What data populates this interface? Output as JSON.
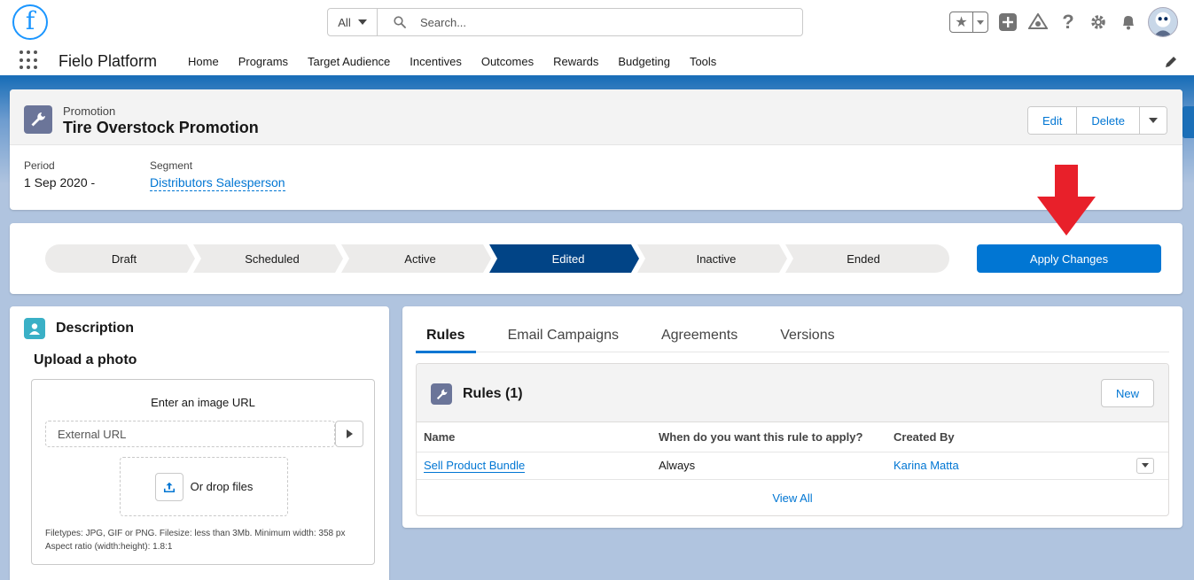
{
  "header": {
    "logo_letter": "f",
    "search": {
      "scope": "All",
      "placeholder": "Search..."
    }
  },
  "icons": {
    "favorites": "star-icon",
    "add": "plus-icon",
    "trailhead": "trailhead-icon",
    "help": "question-icon",
    "setup": "gear-icon",
    "notifications": "bell-icon",
    "avatar": "user-avatar"
  },
  "nav": {
    "app_name": "Fielo Platform",
    "items": [
      "Home",
      "Programs",
      "Target Audience",
      "Incentives",
      "Outcomes",
      "Rewards",
      "Budgeting",
      "Tools"
    ]
  },
  "record": {
    "object_label": "Promotion",
    "title": "Tire Overstock Promotion",
    "actions": {
      "edit": "Edit",
      "delete": "Delete"
    },
    "highlights": [
      {
        "label": "Period",
        "value": "1 Sep 2020 -"
      },
      {
        "label": "Segment",
        "value": "Distributors Salesperson"
      }
    ]
  },
  "path": {
    "steps": [
      "Draft",
      "Scheduled",
      "Active",
      "Edited",
      "Inactive",
      "Ended"
    ],
    "current_step": "Edited",
    "apply_label": "Apply Changes"
  },
  "description": {
    "title": "Description",
    "upload_title": "Upload a photo",
    "url_label": "Enter an image URL",
    "url_placeholder": "External URL",
    "drop_label": "Or drop files",
    "note_line1": "Filetypes: JPG, GIF or PNG. Filesize: less than 3Mb. Minimum width: 358 px",
    "note_line2": "Aspect ratio (width:height): 1.8:1"
  },
  "tabs": {
    "items": [
      "Rules",
      "Email Campaigns",
      "Agreements",
      "Versions"
    ],
    "active": "Rules"
  },
  "rules": {
    "title": "Rules (1)",
    "new_label": "New",
    "columns": [
      "Name",
      "When do you want this rule to apply?",
      "Created By"
    ],
    "rows": [
      {
        "name": "Sell Product Bundle",
        "when": "Always",
        "created_by": "Karina Matta"
      }
    ],
    "view_all": "View All"
  },
  "colors": {
    "brand": "#0176d3",
    "path_active": "#014486",
    "path_inactive": "#ecebea",
    "annotation_arrow": "#e8202a"
  }
}
